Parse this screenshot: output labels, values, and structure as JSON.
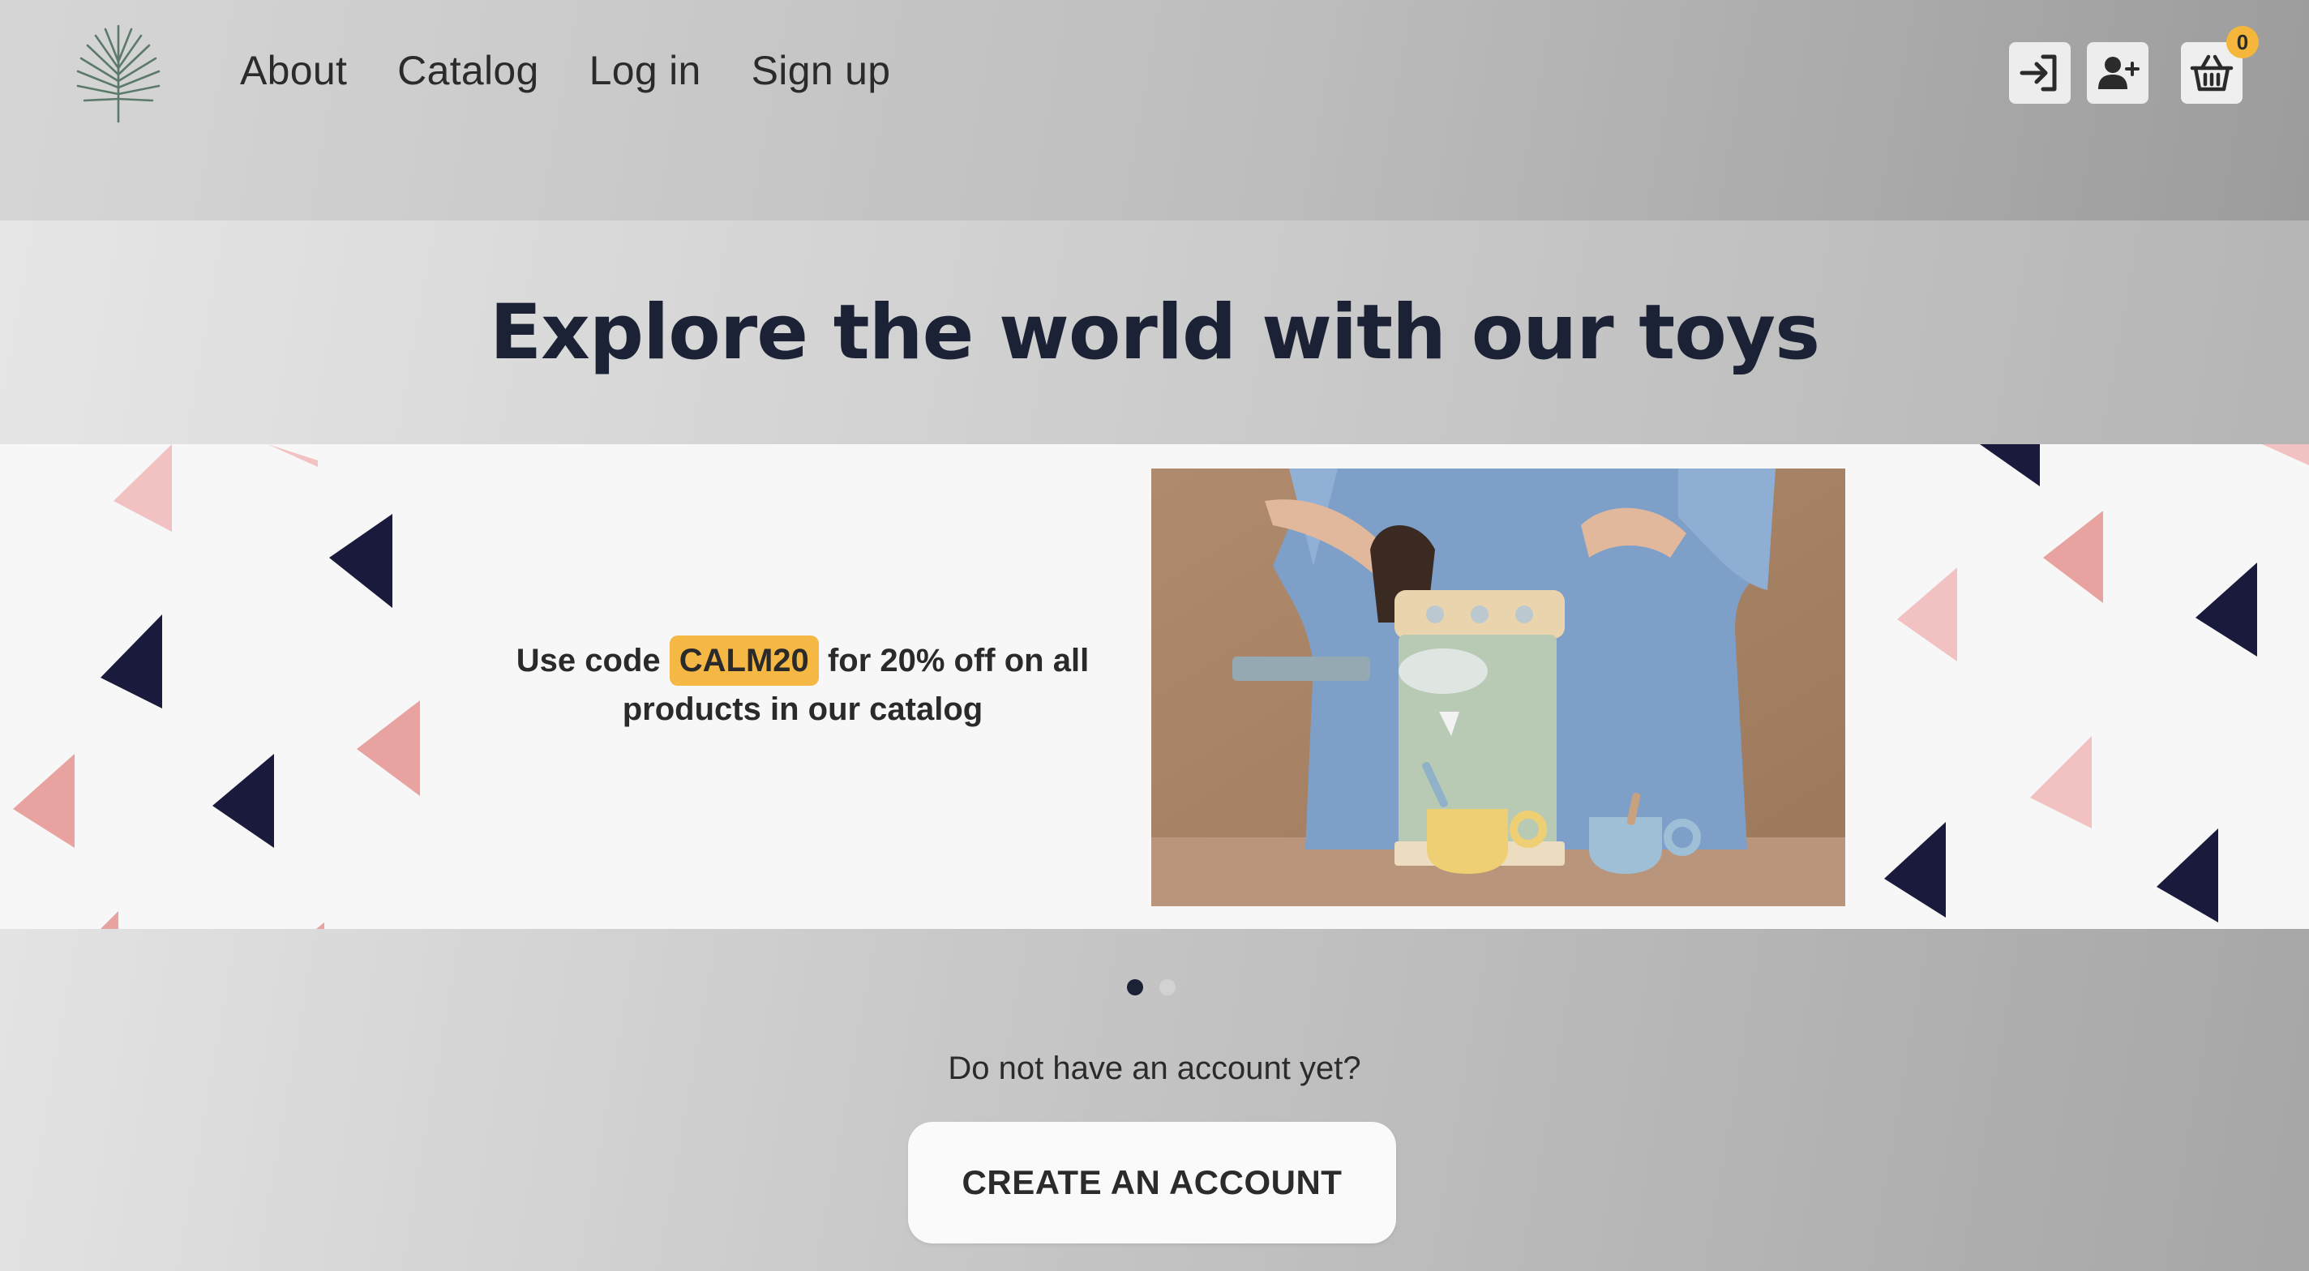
{
  "nav": {
    "items": [
      "About",
      "Catalog",
      "Log in",
      "Sign up"
    ]
  },
  "header_icons": {
    "login": "login-icon",
    "signup": "add-user-icon",
    "cart": "basket-icon",
    "cart_count": "0"
  },
  "hero": {
    "title": "Explore the world with our toys"
  },
  "banner": {
    "promo_prefix": "Use code",
    "promo_code": "CALM20",
    "promo_suffix": "for 20% off on all products in our catalog",
    "slides": 2,
    "active_slide": 1
  },
  "cta": {
    "question": "Do not have an account yet?",
    "button_label": "CREATE AN ACCOUNT"
  },
  "colors": {
    "navy": "#1b2236",
    "accent_yellow": "#f5b844",
    "pink": "#e8a3a0"
  }
}
